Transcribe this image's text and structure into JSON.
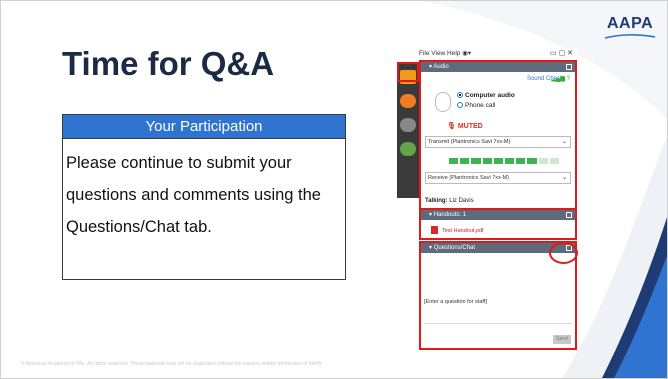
{
  "slide": {
    "title": "Time for Q&A",
    "logo": "AAPA",
    "participation_header": "Your Participation",
    "participation_body": "Please continue to submit your questions and comments using the Questions/Chat tab.",
    "footer": "© American Academy of PAs. All rights reserved. These materials may not be duplicated without the express written permission of AAPA."
  },
  "gtw": {
    "menu": "File  View  Help  ◉▾",
    "window_controls": "▭ ▢ ✕",
    "audio": {
      "header": "Audio",
      "sound_check": "Sound Check",
      "computer_audio": "Computer audio",
      "phone_call": "Phone call",
      "muted": "MUTED",
      "transmit": "Transmit (Plantronics Savi 7xx-M)",
      "receive": "Receive (Plantronics Savi 7xx-M)",
      "talking_label": "Talking:",
      "talking_name": "Liz Davis"
    },
    "handouts": {
      "header": "Handouts: 1",
      "file": "Test Handout.pdf"
    },
    "questions": {
      "header": "Questions/Chat",
      "placeholder": "[Enter a question for staff]",
      "send": "Send"
    }
  },
  "colors": {
    "accent_blue": "#2f74d0",
    "highlight_red": "#e01919",
    "title_navy": "#1c2a44"
  }
}
